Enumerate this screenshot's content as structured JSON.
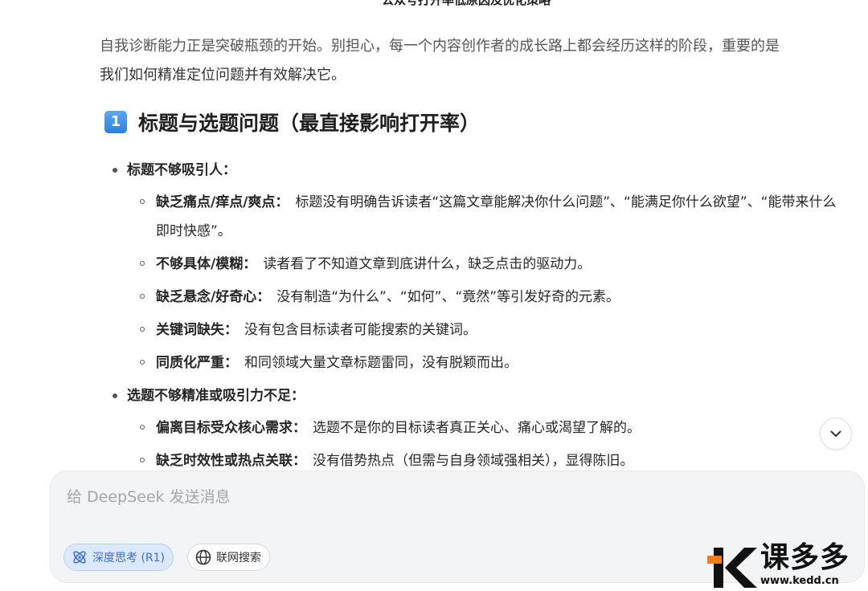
{
  "document": {
    "title": "公众号打开率低原因及优化策略"
  },
  "intro": {
    "line1": "自我诊断能力正是突破瓶颈的开始。别担心，每一个内容创作者的成长路上都会经历这样的阶段，重要的是",
    "line2": "我们如何精准定位问题并有效解决它。"
  },
  "section": {
    "number": "1",
    "title": "标题与选题问题（最直接影响打开率）"
  },
  "groups": [
    {
      "label": "标题不够吸引人：",
      "items": [
        {
          "title": "缺乏痛点/痒点/爽点：",
          "text": "标题没有明确告诉读者“这篇文章能解决你什么问题”、“能满足你什么欲望”、“能带来什么即时快感”。"
        },
        {
          "title": "不够具体/模糊：",
          "text": "读者看了不知道文章到底讲什么，缺乏点击的驱动力。"
        },
        {
          "title": "缺乏悬念/好奇心：",
          "text": "没有制造“为什么”、“如何”、“竟然”等引发好奇的元素。"
        },
        {
          "title": "关键词缺失：",
          "text": "没有包含目标读者可能搜索的关键词。"
        },
        {
          "title": "同质化严重：",
          "text": "和同领域大量文章标题雷同，没有脱颖而出。"
        }
      ]
    },
    {
      "label": "选题不够精准或吸引力不足：",
      "items": [
        {
          "title": "偏离目标受众核心需求：",
          "text": "选题不是你的目标读者真正关心、痛心或渴望了解的。"
        },
        {
          "title": "缺乏时效性或热点关联：",
          "text": "没有借势热点（但需与自身领域强相关），显得陈旧。"
        }
      ]
    }
  ],
  "composer": {
    "placeholder": "给 DeepSeek 发送消息",
    "deep_think_label": "深度思考 (R1)",
    "web_search_label": "联网搜索"
  },
  "watermark": {
    "text": "课多多",
    "url": "www.kedd.cn"
  },
  "icons": {
    "scroll_down": "chevron-down-icon",
    "deep_think": "atom-icon",
    "web_search": "globe-icon"
  },
  "colors": {
    "accent": "#3b6fd8",
    "badge": "#2f7fd8",
    "composer_bg": "#f3f4f6"
  }
}
